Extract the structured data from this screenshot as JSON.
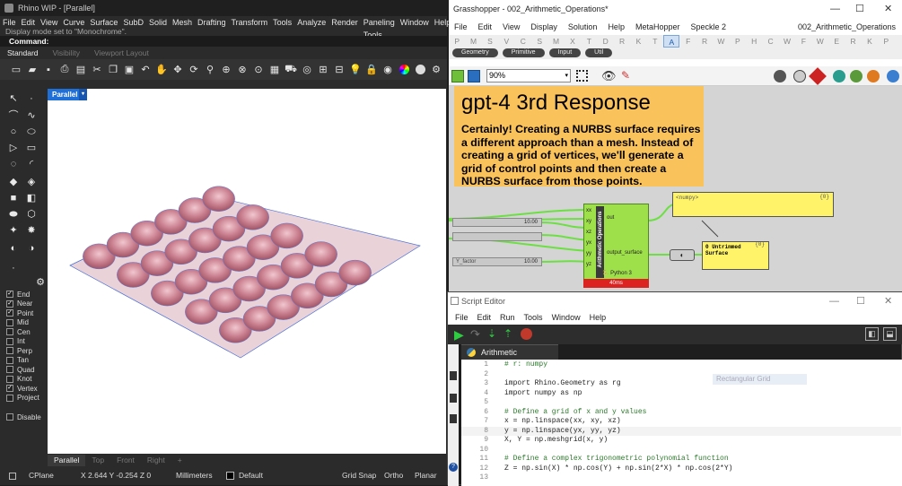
{
  "rhino": {
    "title": "Rhino WIP - [Parallel]",
    "menu": [
      "File",
      "Edit",
      "View",
      "Curve",
      "Surface",
      "SubD",
      "Solid",
      "Mesh",
      "Drafting",
      "Transform",
      "Tools",
      "Analyze",
      "Render",
      "Paneling Tools",
      "Window",
      "Help"
    ],
    "command_history": "Display mode set to \"Monochrome\".",
    "command_label": "Command:",
    "toolbar_tabs": [
      "Standard",
      "Visibility",
      "Viewport Layout"
    ],
    "viewport_label": "Parallel",
    "viewport_tabs": [
      "Parallel",
      "Top",
      "Front",
      "Right",
      "+"
    ],
    "osnaps": [
      {
        "label": "End",
        "checked": true
      },
      {
        "label": "Near",
        "checked": true
      },
      {
        "label": "Point",
        "checked": true
      },
      {
        "label": "Mid",
        "checked": false
      },
      {
        "label": "Cen",
        "checked": false
      },
      {
        "label": "Int",
        "checked": false
      },
      {
        "label": "Perp",
        "checked": false
      },
      {
        "label": "Tan",
        "checked": false
      },
      {
        "label": "Quad",
        "checked": false
      },
      {
        "label": "Knot",
        "checked": false
      },
      {
        "label": "Vertex",
        "checked": true
      },
      {
        "label": "Project",
        "checked": false
      }
    ],
    "disable_label": "Disable",
    "status": {
      "cplane": "CPlane",
      "coords": "X 2.644  Y -0.254  Z 0",
      "units": "Millimeters",
      "layer": "Default",
      "grid_snap": "Grid Snap",
      "ortho": "Ortho",
      "planar": "Planar"
    }
  },
  "grasshopper": {
    "title": "Grasshopper - 002_Arithmetic_Operations*",
    "menu": [
      "File",
      "Edit",
      "View",
      "Display",
      "Solution",
      "Help",
      "MetaHopper",
      "Speckle 2"
    ],
    "doc_name": "002_Arithmetic_Operations",
    "tabs": [
      "P",
      "M",
      "S",
      "V",
      "C",
      "S",
      "M",
      "X",
      "T",
      "D",
      "R",
      "K",
      "T",
      "A",
      "F",
      "R",
      "W",
      "P",
      "H",
      "C",
      "W",
      "F",
      "W",
      "E",
      "R",
      "K",
      "P"
    ],
    "active_tab_index": 13,
    "subtabs": [
      "Geometry",
      "Primitive",
      "Input",
      "Util"
    ],
    "zoom": "90%",
    "panel_heading": "gpt-4 3rd Response",
    "panel_body": "Certainly! Creating a NURBS surface requires a different approach than a mesh. Instead of creating a grid of vertices, we'll generate a grid of control points and then create a NURBS surface from those points.",
    "sliders": [
      {
        "label": "",
        "value": "10.00"
      },
      {
        "label": "",
        "value": ""
      },
      {
        "label": "Y_factor",
        "value": "10.00"
      }
    ],
    "component": {
      "name": "Arithmetic Operations",
      "inputs": [
        "xx",
        "xy",
        "xz",
        "yx",
        "yy",
        "yz"
      ],
      "outputs": [
        "out",
        "output_surface"
      ],
      "footer": "Python 3",
      "timing": "40ms"
    },
    "output_panel_1": "<numpy>",
    "output_panel_2": "0 Untrimmed Surface",
    "output_panel_counter": "{0}"
  },
  "script_editor": {
    "title": "Script Editor",
    "menu": [
      "File",
      "Edit",
      "Run",
      "Tools",
      "Window",
      "Help"
    ],
    "tab_label": "Arithmetic Operations",
    "ghost_hint": "Rectangular Grid",
    "lines": [
      {
        "n": "1",
        "t": "# r: numpy",
        "c": true
      },
      {
        "n": "2",
        "t": "",
        "c": false
      },
      {
        "n": "3",
        "t": "import Rhino.Geometry as rg",
        "c": false
      },
      {
        "n": "4",
        "t": "import numpy as np",
        "c": false
      },
      {
        "n": "5",
        "t": "",
        "c": false
      },
      {
        "n": "6",
        "t": "# Define a grid of x and y values",
        "c": true
      },
      {
        "n": "7",
        "t": "x = np.linspace(xx, xy, xz)",
        "c": false
      },
      {
        "n": "8",
        "t": "y = np.linspace(yx, yy, yz)",
        "c": false
      },
      {
        "n": "9",
        "t": "X, Y = np.meshgrid(x, y)",
        "c": false
      },
      {
        "n": "10",
        "t": "",
        "c": false
      },
      {
        "n": "11",
        "t": "# Define a complex trigonometric polynomial function",
        "c": true
      },
      {
        "n": "12",
        "t": "Z = np.sin(X) * np.cos(Y) + np.sin(2*X) * np.cos(2*Y)",
        "c": false
      },
      {
        "n": "13",
        "t": "",
        "c": false
      }
    ]
  }
}
